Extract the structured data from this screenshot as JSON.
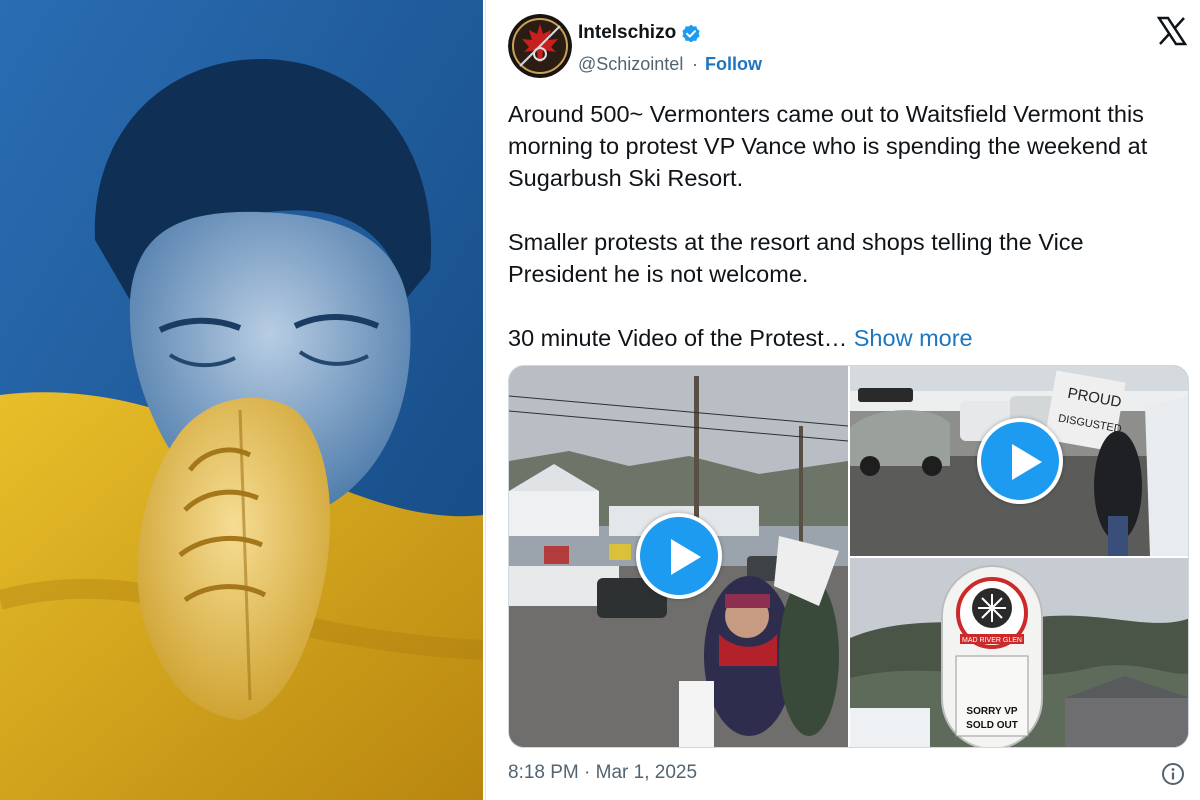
{
  "tweet": {
    "author": {
      "display_name": "Intelschizo",
      "handle": "@Schizointel",
      "separator": "·",
      "follow_label": "Follow"
    },
    "platform_logo": "x-logo-icon",
    "text": {
      "paragraph_1": "Around 500~ Vermonters came out to Waitsfield Vermont this morning to protest VP Vance who is spending the weekend at Sugarbush Ski Resort.",
      "paragraph_2": "Smaller protests at the resort and shops telling the Vice President he is not welcome.",
      "paragraph_3": "30 minute Video of the Protest…",
      "show_more": "Show more"
    },
    "media": {
      "sign_text": "PROUD",
      "sign_text_2": "DISGUSTED",
      "resort_sign": "MAD RIVER GLEN",
      "marquee_line_1": "SORRY VP",
      "marquee_line_2": "SOLD OUT"
    },
    "timestamp": "8:18 PM · Mar 1, 2025"
  },
  "colors": {
    "link": "#1d76bf",
    "verified": "#1d9bf0",
    "ukraine_blue": "#1f5fa8",
    "ukraine_yellow": "#e5b520"
  }
}
